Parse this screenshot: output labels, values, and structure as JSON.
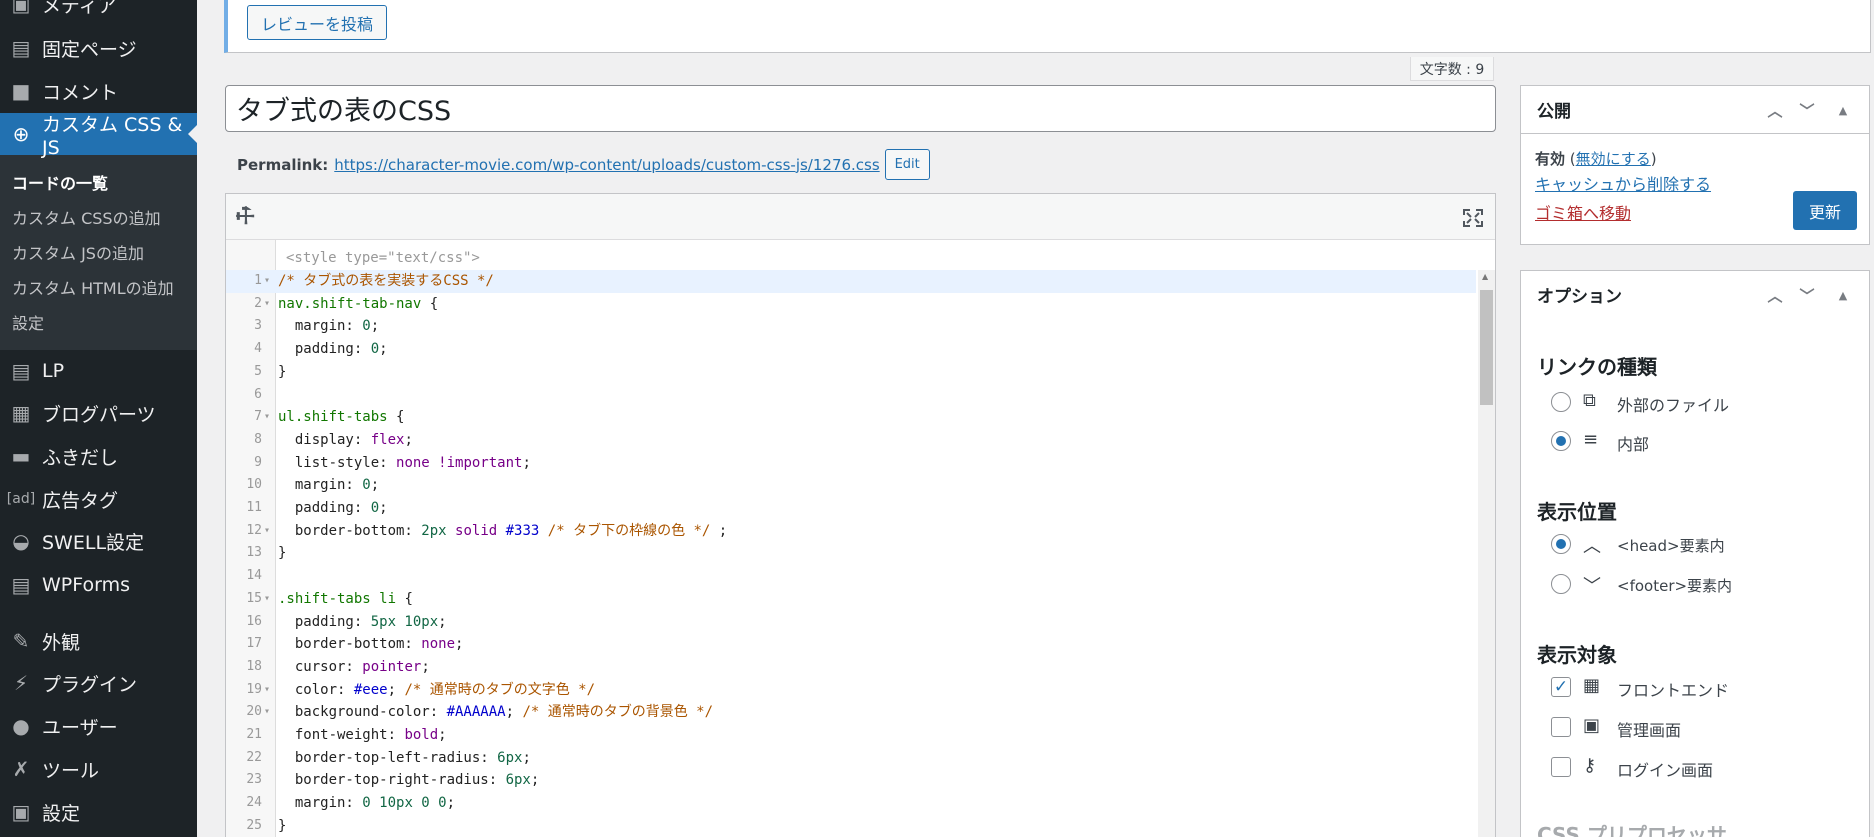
{
  "sidebar": {
    "items": [
      {
        "label": "メディア",
        "icon": "media-icon",
        "glyph": "▣"
      },
      {
        "label": "固定ページ",
        "icon": "page-icon",
        "glyph": "▤"
      },
      {
        "label": "コメント",
        "icon": "comment-icon",
        "glyph": "■"
      },
      {
        "label": "カスタム CSS & JS",
        "icon": "plus-circle-icon",
        "glyph": "⊕"
      },
      {
        "label": "LP",
        "icon": "document-icon",
        "glyph": "▤"
      },
      {
        "label": "ブログパーツ",
        "icon": "layout-icon",
        "glyph": "▦"
      },
      {
        "label": "ふきだし",
        "icon": "speech-bubble-icon",
        "glyph": "▬"
      },
      {
        "label": "広告タグ",
        "icon": "ad-icon",
        "glyph": "[ad]"
      },
      {
        "label": "SWELL設定",
        "icon": "swell-icon",
        "glyph": "◒"
      },
      {
        "label": "WPForms",
        "icon": "forms-icon",
        "glyph": "▤"
      },
      {
        "label": "外観",
        "icon": "brush-icon",
        "glyph": "✎"
      },
      {
        "label": "プラグイン",
        "icon": "plugin-icon",
        "glyph": "⚡"
      },
      {
        "label": "ユーザー",
        "icon": "user-icon",
        "glyph": "●"
      },
      {
        "label": "ツール",
        "icon": "wrench-icon",
        "glyph": "✗"
      },
      {
        "label": "設定",
        "icon": "settings-icon",
        "glyph": "▣"
      }
    ],
    "submenu": [
      "コードの一覧",
      "カスタム CSSの追加",
      "カスタム JSの追加",
      "カスタム HTMLの追加",
      "設定"
    ]
  },
  "notice": {
    "review_button": "レビューを投稿"
  },
  "char_count": "文字数 : 9",
  "title": "タブ式の表のCSS",
  "permalink": {
    "label": "Permalink:",
    "url": "https://character-movie.com/wp-content/uploads/custom-css-js/1276.css",
    "edit": "Edit"
  },
  "editor": {
    "style_hint": "<style type=\"text/css\">",
    "lines": [
      {
        "n": "1",
        "fold": true,
        "hl": true,
        "tokens": [
          [
            "c",
            "/* タブ式の表を実装するCSS */"
          ]
        ]
      },
      {
        "n": "2",
        "fold": true,
        "tokens": [
          [
            "s",
            "nav.shift-tab-nav"
          ],
          [
            "p",
            " {"
          ]
        ]
      },
      {
        "n": "3",
        "tokens": [
          [
            "p",
            "  margin: "
          ],
          [
            "n",
            "0"
          ],
          [
            "p",
            ";"
          ]
        ]
      },
      {
        "n": "4",
        "tokens": [
          [
            "p",
            "  padding: "
          ],
          [
            "n",
            "0"
          ],
          [
            "p",
            ";"
          ]
        ]
      },
      {
        "n": "5",
        "tokens": [
          [
            "p",
            "}"
          ]
        ]
      },
      {
        "n": "6",
        "tokens": []
      },
      {
        "n": "7",
        "fold": true,
        "tokens": [
          [
            "s",
            "ul.shift-tabs"
          ],
          [
            "p",
            " {"
          ]
        ]
      },
      {
        "n": "8",
        "tokens": [
          [
            "p",
            "  display: "
          ],
          [
            "k",
            "flex"
          ],
          [
            "p",
            ";"
          ]
        ]
      },
      {
        "n": "9",
        "tokens": [
          [
            "p",
            "  list-style: "
          ],
          [
            "k",
            "none !important"
          ],
          [
            "p",
            ";"
          ]
        ]
      },
      {
        "n": "10",
        "tokens": [
          [
            "p",
            "  margin: "
          ],
          [
            "n",
            "0"
          ],
          [
            "p",
            ";"
          ]
        ]
      },
      {
        "n": "11",
        "tokens": [
          [
            "p",
            "  padding: "
          ],
          [
            "n",
            "0"
          ],
          [
            "p",
            ";"
          ]
        ]
      },
      {
        "n": "12",
        "fold": true,
        "tokens": [
          [
            "p",
            "  border-bottom: "
          ],
          [
            "n",
            "2px"
          ],
          [
            "p",
            " "
          ],
          [
            "k",
            "solid"
          ],
          [
            "p",
            " "
          ],
          [
            "x",
            "#333"
          ],
          [
            "p",
            " "
          ],
          [
            "c",
            "/* タブ下の枠線の色 */"
          ],
          [
            "p",
            " ;"
          ]
        ]
      },
      {
        "n": "13",
        "tokens": [
          [
            "p",
            "}"
          ]
        ]
      },
      {
        "n": "14",
        "tokens": []
      },
      {
        "n": "15",
        "fold": true,
        "tokens": [
          [
            "s",
            ".shift-tabs li"
          ],
          [
            "p",
            " {"
          ]
        ]
      },
      {
        "n": "16",
        "tokens": [
          [
            "p",
            "  padding: "
          ],
          [
            "n",
            "5px 10px"
          ],
          [
            "p",
            ";"
          ]
        ]
      },
      {
        "n": "17",
        "tokens": [
          [
            "p",
            "  border-bottom: "
          ],
          [
            "k",
            "none"
          ],
          [
            "p",
            ";"
          ]
        ]
      },
      {
        "n": "18",
        "tokens": [
          [
            "p",
            "  cursor: "
          ],
          [
            "k",
            "pointer"
          ],
          [
            "p",
            ";"
          ]
        ]
      },
      {
        "n": "19",
        "fold": true,
        "tokens": [
          [
            "p",
            "  color: "
          ],
          [
            "x",
            "#eee"
          ],
          [
            "p",
            "; "
          ],
          [
            "c",
            "/* 通常時のタブの文字色 */"
          ]
        ]
      },
      {
        "n": "20",
        "fold": true,
        "tokens": [
          [
            "p",
            "  background-color: "
          ],
          [
            "x",
            "#AAAAAA"
          ],
          [
            "p",
            "; "
          ],
          [
            "c",
            "/* 通常時のタブの背景色 */"
          ]
        ]
      },
      {
        "n": "21",
        "tokens": [
          [
            "p",
            "  font-weight: "
          ],
          [
            "k",
            "bold"
          ],
          [
            "p",
            ";"
          ]
        ]
      },
      {
        "n": "22",
        "tokens": [
          [
            "p",
            "  border-top-left-radius: "
          ],
          [
            "n",
            "6px"
          ],
          [
            "p",
            ";"
          ]
        ]
      },
      {
        "n": "23",
        "tokens": [
          [
            "p",
            "  border-top-right-radius: "
          ],
          [
            "n",
            "6px"
          ],
          [
            "p",
            ";"
          ]
        ]
      },
      {
        "n": "24",
        "tokens": [
          [
            "p",
            "  margin: "
          ],
          [
            "n",
            "0 10px 0 0"
          ],
          [
            "p",
            ";"
          ]
        ]
      },
      {
        "n": "25",
        "tokens": [
          [
            "p",
            "}"
          ]
        ]
      }
    ]
  },
  "publish": {
    "title": "公開",
    "status_label": "有効",
    "disable_link": "無効にする",
    "cache_link": "キャッシュから削除する",
    "trash_link": "ゴミ箱へ移動",
    "update_button": "更新"
  },
  "options": {
    "title": "オプション",
    "link_type_heading": "リンクの種類",
    "link_external": "外部のファイル",
    "link_internal": "内部",
    "position_heading": "表示位置",
    "position_head": "<head>要素内",
    "position_footer": "<footer>要素内",
    "target_heading": "表示対象",
    "target_frontend": "フロントエンド",
    "target_admin": "管理画面",
    "target_login": "ログイン画面",
    "preprocessor_heading": "CSS プリプロセッサ"
  },
  "colors": {
    "accent": "#2271b1",
    "sidebar": "#1d2327",
    "trash": "#b32d2e"
  }
}
